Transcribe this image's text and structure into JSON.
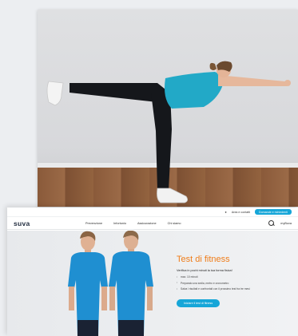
{
  "video": {
    "scene": "exercise-demo-frame"
  },
  "site": {
    "topbar": {
      "icon": "person-icon",
      "link": "Area e contatti",
      "button": "Domande e richiedenti"
    },
    "nav": {
      "logo": "suva",
      "items": [
        "Prevenzione",
        "Infortunio",
        "Assicurazione",
        "Chi siamo"
      ],
      "account": "myBuva"
    },
    "hero": {
      "title": "Test di fitness",
      "subtitle": "Verifica in pochi minuti la tua forma fisica!",
      "bullets": [
        "max. 10 minuti",
        "Preparato una sedia, metro e cronometro",
        "Salva i risultati e confrontali con il prossimo test fra tre mesi"
      ],
      "cta": "Iniziare il test di fitness"
    },
    "colors": {
      "accent_blue": "#16a6d8",
      "accent_orange": "#ef7d1a",
      "shirt": "#1f8fd1"
    }
  }
}
